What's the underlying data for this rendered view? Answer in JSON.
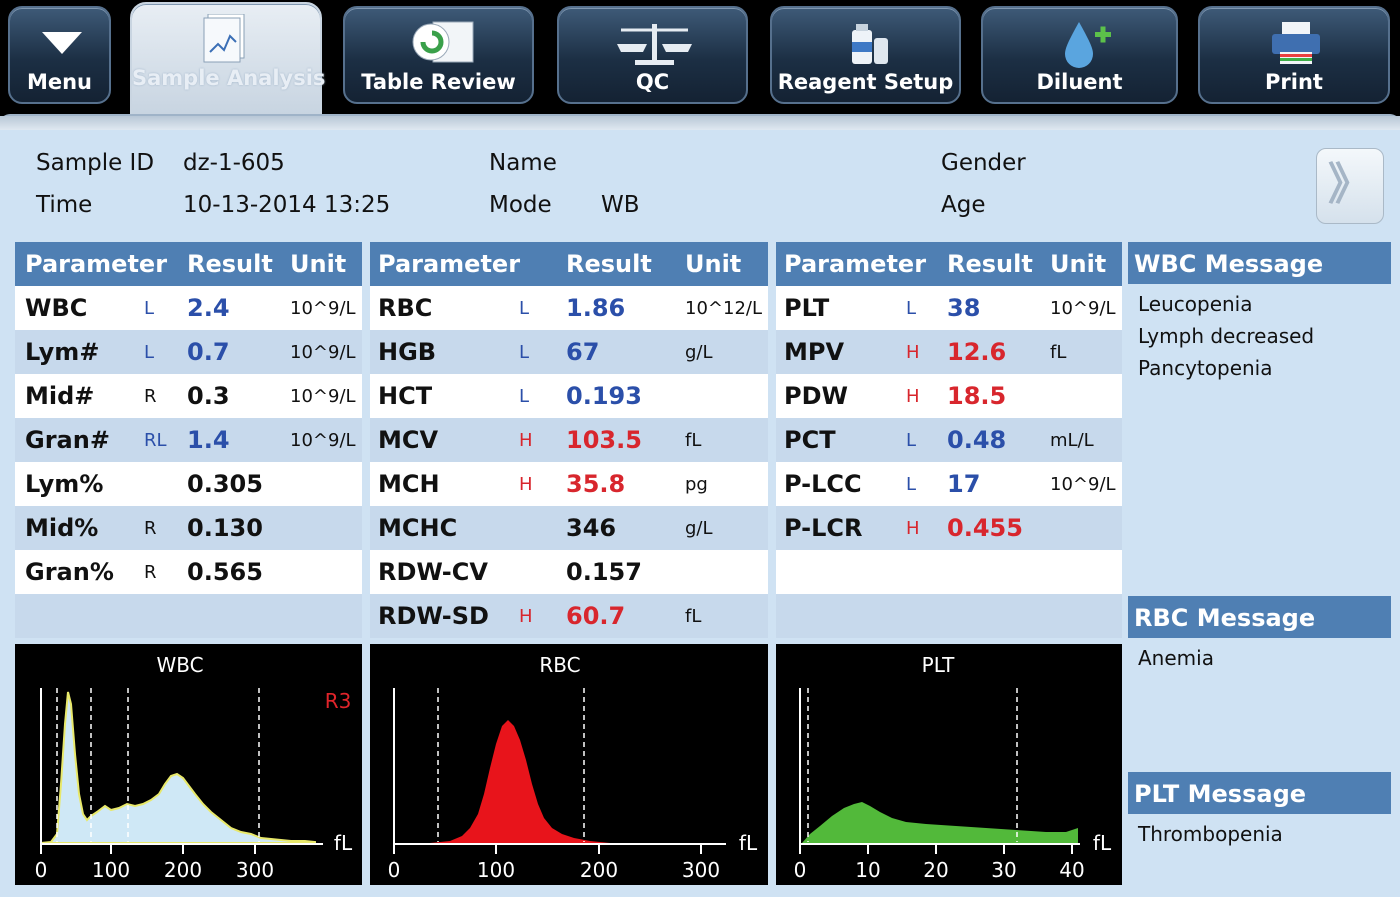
{
  "toolbar": {
    "menu": "Menu",
    "sample_analysis": "Sample Analysis",
    "table_review": "Table Review",
    "qc": "QC",
    "reagent_setup": "Reagent Setup",
    "diluent": "Diluent",
    "print": "Print"
  },
  "header": {
    "sample_id_label": "Sample ID",
    "sample_id": "dz-1-605",
    "time_label": "Time",
    "time": "10-13-2014 13:25",
    "name_label": "Name",
    "mode_label": "Mode",
    "mode": "WB",
    "gender_label": "Gender",
    "age_label": "Age",
    "next_glyph": "》"
  },
  "columns": {
    "parameter": "Parameter",
    "result": "Result",
    "unit": "Unit"
  },
  "wbc_table": [
    {
      "p": "WBC",
      "f": "L",
      "v": "2.4",
      "u": "10^9/L",
      "c": "lo"
    },
    {
      "p": "Lym#",
      "f": "L",
      "v": "0.7",
      "u": "10^9/L",
      "c": "lo"
    },
    {
      "p": "Mid#",
      "f": "R",
      "v": "0.3",
      "u": "10^9/L",
      "c": ""
    },
    {
      "p": "Gran#",
      "f": "RL",
      "v": "1.4",
      "u": "10^9/L",
      "c": "lo"
    },
    {
      "p": "Lym%",
      "f": "",
      "v": "0.305",
      "u": "",
      "c": ""
    },
    {
      "p": "Mid%",
      "f": "R",
      "v": "0.130",
      "u": "",
      "c": ""
    },
    {
      "p": "Gran%",
      "f": "R",
      "v": "0.565",
      "u": "",
      "c": ""
    }
  ],
  "rbc_table": [
    {
      "p": "RBC",
      "f": "L",
      "v": "1.86",
      "u": "10^12/L",
      "c": "lo"
    },
    {
      "p": "HGB",
      "f": "L",
      "v": "67",
      "u": "g/L",
      "c": "lo"
    },
    {
      "p": "HCT",
      "f": "L",
      "v": "0.193",
      "u": "",
      "c": "lo"
    },
    {
      "p": "MCV",
      "f": "H",
      "v": "103.5",
      "u": "fL",
      "c": "hi"
    },
    {
      "p": "MCH",
      "f": "H",
      "v": "35.8",
      "u": "pg",
      "c": "hi"
    },
    {
      "p": "MCHC",
      "f": "",
      "v": "346",
      "u": "g/L",
      "c": ""
    },
    {
      "p": "RDW-CV",
      "f": "",
      "v": "0.157",
      "u": "",
      "c": ""
    },
    {
      "p": "RDW-SD",
      "f": "H",
      "v": "60.7",
      "u": "fL",
      "c": "hi"
    }
  ],
  "plt_table": [
    {
      "p": "PLT",
      "f": "L",
      "v": "38",
      "u": "10^9/L",
      "c": "lo"
    },
    {
      "p": "MPV",
      "f": "H",
      "v": "12.6",
      "u": "fL",
      "c": "hi"
    },
    {
      "p": "PDW",
      "f": "H",
      "v": "18.5",
      "u": "",
      "c": "hi"
    },
    {
      "p": "PCT",
      "f": "L",
      "v": "0.48",
      "u": "mL/L",
      "c": "lo"
    },
    {
      "p": "P-LCC",
      "f": "L",
      "v": "17",
      "u": "10^9/L",
      "c": "lo"
    },
    {
      "p": "P-LCR",
      "f": "H",
      "v": "0.455",
      "u": "",
      "c": "hi"
    }
  ],
  "messages": {
    "wbc_title": "WBC Message",
    "wbc": [
      "Leucopenia",
      "Lymph decreased",
      "Pancytopenia"
    ],
    "rbc_title": "RBC Message",
    "rbc": [
      "Anemia"
    ],
    "plt_title": "PLT Message",
    "plt": [
      "Thrombopenia"
    ]
  },
  "histograms": {
    "wbc": {
      "title": "WBC",
      "unit": "fL",
      "marker": "R3",
      "ticks": [
        "0",
        "100",
        "200",
        "300"
      ],
      "color": "#cfe8f6"
    },
    "rbc": {
      "title": "RBC",
      "unit": "fL",
      "ticks": [
        "0",
        "100",
        "200",
        "300"
      ],
      "color": "#e8141b"
    },
    "plt": {
      "title": "PLT",
      "unit": "fL",
      "ticks": [
        "0",
        "10",
        "20",
        "30",
        "40"
      ],
      "color": "#52b93a"
    }
  }
}
